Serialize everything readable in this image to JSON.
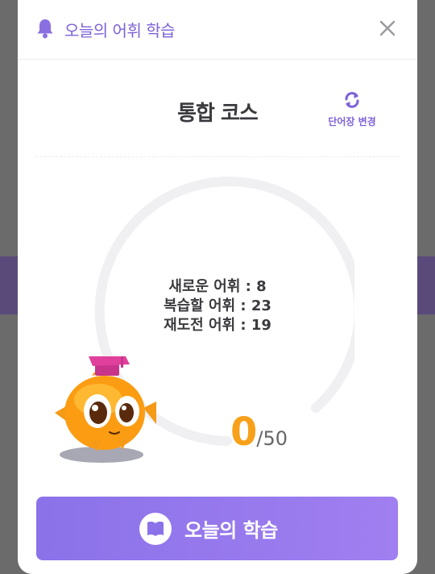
{
  "header": {
    "title": "오늘의 어휘 학습"
  },
  "course": {
    "title": "통합 코스",
    "change_label": "단어장 변경"
  },
  "stats": {
    "new_label": "새로운 어휘",
    "new_value": "8",
    "review_label": "복습할 어휘",
    "review_value": "23",
    "retry_label": "재도전 어휘",
    "retry_value": "19"
  },
  "progress": {
    "current": "0",
    "total": "/50",
    "fraction": 0
  },
  "start_button": {
    "label": "오늘의 학습"
  },
  "colors": {
    "accent": "#7d62d8",
    "count": "#f7a11a",
    "ring": "#f0f0f3"
  },
  "icons": {
    "header": "bell-icon",
    "close": "close-icon",
    "change": "refresh-icon",
    "button": "book-icon"
  }
}
